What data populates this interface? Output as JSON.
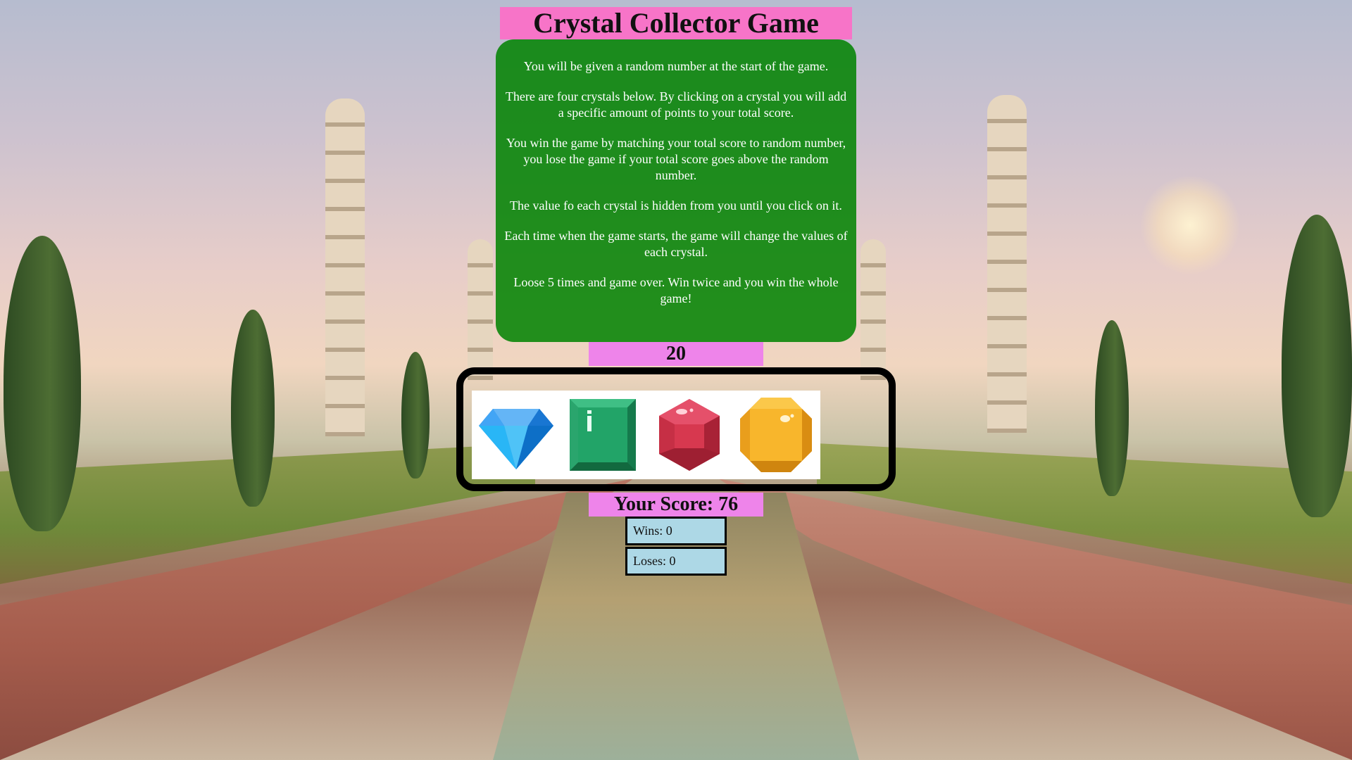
{
  "game": {
    "title": "Crystal Collector Game",
    "instructions": [
      "You will be given a random number at the start of the game.",
      "There are four crystals below. By clicking on a crystal you will add a specific amount of points to your total score.",
      "You win the game by matching your total score to random number, you lose the game if your total score goes above the random number.",
      "The value fo each crystal is hidden from you until you click on it.",
      "Each time when the game starts, the game will change the values of each crystal.",
      "Loose 5 times and game over. Win twice and you win the whole game!"
    ],
    "target_number": "20",
    "score_text": "Your Score: 76",
    "wins_text": "Wins: 0",
    "loses_text": "Loses: 0"
  },
  "crystals": [
    {
      "icon": "blue-diamond-icon",
      "color": "#2196e8"
    },
    {
      "icon": "green-emerald-icon",
      "color": "#1ea56b"
    },
    {
      "icon": "red-ruby-icon",
      "color": "#d7384f"
    },
    {
      "icon": "yellow-topaz-icon",
      "color": "#f8b62c"
    }
  ],
  "colors": {
    "title_bg": "#f774c8",
    "panel_bg": "#008200",
    "score_bg": "#ee84ea",
    "counter_bg": "#add8e6"
  }
}
